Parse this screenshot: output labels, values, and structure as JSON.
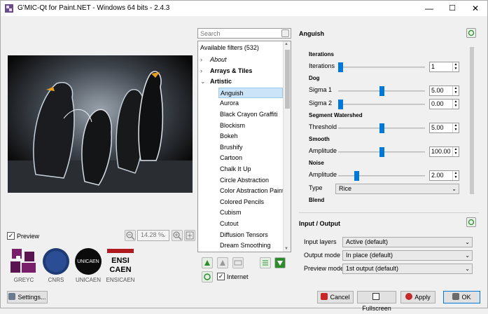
{
  "window": {
    "title": "G'MIC-Qt for Paint.NET - Windows 64 bits - 2.4.3",
    "minimize": "—",
    "maximize": "☐",
    "close": "✕"
  },
  "preview": {
    "checkbox_label": "Preview",
    "checked": true,
    "zoom_value": "14.28 %"
  },
  "logos": [
    "GREYC",
    "CNRS",
    "UNICAEN",
    "ENSICAEN"
  ],
  "logo_texts": {
    "unicaen": "UNICAEN",
    "ensi_line1": "ENSI",
    "ensi_line2": "CAEN"
  },
  "settings_label": "Settings...",
  "search_placeholder": "Search",
  "filters": {
    "header": "Available filters (532)",
    "items": [
      {
        "label": "About",
        "kind": "collapsed",
        "italic": true
      },
      {
        "label": "Arrays & Tiles",
        "kind": "collapsed"
      },
      {
        "label": "Artistic",
        "kind": "expanded"
      },
      {
        "label": "Anguish",
        "kind": "child",
        "selected": true
      },
      {
        "label": "Aurora",
        "kind": "child"
      },
      {
        "label": "Black Crayon Graffiti",
        "kind": "child"
      },
      {
        "label": "Blockism",
        "kind": "child"
      },
      {
        "label": "Bokeh",
        "kind": "child"
      },
      {
        "label": "Brushify",
        "kind": "child"
      },
      {
        "label": "Cartoon",
        "kind": "child"
      },
      {
        "label": "Chalk It Up",
        "kind": "child"
      },
      {
        "label": "Circle Abstraction",
        "kind": "child"
      },
      {
        "label": "Color Abstraction Paint",
        "kind": "child"
      },
      {
        "label": "Colored Pencils",
        "kind": "child"
      },
      {
        "label": "Cubism",
        "kind": "child"
      },
      {
        "label": "Cutout",
        "kind": "child"
      },
      {
        "label": "Diffusion Tensors",
        "kind": "child"
      },
      {
        "label": "Dream Smoothing",
        "kind": "child"
      }
    ],
    "internet_label": "Internet",
    "internet_checked": true
  },
  "filter_panel": {
    "title": "Anguish",
    "sections": [
      {
        "kind": "section",
        "label": "Iterations"
      },
      {
        "kind": "slider",
        "label": "Iterations",
        "value": "1",
        "level": 0.0
      },
      {
        "kind": "section",
        "label": "Dog"
      },
      {
        "kind": "slider",
        "label": "Sigma 1",
        "value": "5.00",
        "level": 0.5
      },
      {
        "kind": "slider",
        "label": "Sigma 2",
        "value": "0.00",
        "level": 0.0
      },
      {
        "kind": "section",
        "label": "Segment Watershed"
      },
      {
        "kind": "slider",
        "label": "Threshold",
        "value": "5.00",
        "level": 0.5
      },
      {
        "kind": "section",
        "label": "Smooth"
      },
      {
        "kind": "slider",
        "label": "Amplitude",
        "value": "100.00",
        "level": 0.5
      },
      {
        "kind": "section",
        "label": "Noise"
      },
      {
        "kind": "slider",
        "label": "Amplitude",
        "value": "2.00",
        "level": 0.2
      },
      {
        "kind": "combo",
        "label": "Type",
        "value": "Rice"
      },
      {
        "kind": "section",
        "label": "Blend"
      }
    ]
  },
  "io": {
    "title": "Input / Output",
    "rows": [
      {
        "label": "Input layers",
        "value": "Active (default)"
      },
      {
        "label": "Output mode",
        "value": "In place (default)"
      },
      {
        "label": "Preview mode",
        "value": "1st output (default)"
      }
    ]
  },
  "buttons": {
    "cancel": "Cancel",
    "fullscreen": "Fullscreen",
    "apply": "Apply",
    "ok": "OK"
  },
  "colors": {
    "accent": "#0078d7",
    "selection": "#cce4f7",
    "greyc_purple": "#7a1d6a"
  }
}
